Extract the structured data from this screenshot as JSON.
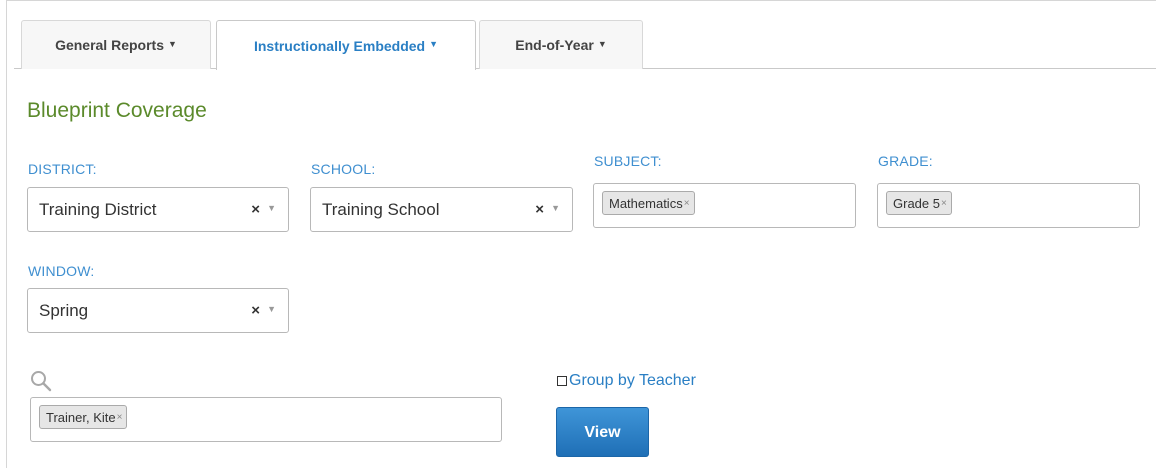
{
  "tabs": [
    {
      "label": "General Reports",
      "active": false
    },
    {
      "label": "Instructionally Embedded",
      "active": true
    },
    {
      "label": "End-of-Year",
      "active": false
    }
  ],
  "page": {
    "title": "Blueprint Coverage"
  },
  "filters": {
    "district": {
      "label": "DISTRICT:",
      "value": "Training District"
    },
    "school": {
      "label": "SCHOOL:",
      "value": "Training School"
    },
    "subject": {
      "label": "SUBJECT:",
      "chip": "Mathematics"
    },
    "grade": {
      "label": "GRADE:",
      "chip": "Grade 5"
    },
    "window": {
      "label": "WINDOW:",
      "value": "Spring"
    }
  },
  "search": {
    "chip": "Trainer, Kite",
    "icon": "search-icon"
  },
  "group_by_teacher": {
    "label": "Group by Teacher",
    "checked": false
  },
  "view_button": {
    "label": "View"
  },
  "colors": {
    "accent_blue": "#2a7fc4",
    "title_green": "#5b8a2b",
    "label_blue": "#3f8fd0"
  }
}
